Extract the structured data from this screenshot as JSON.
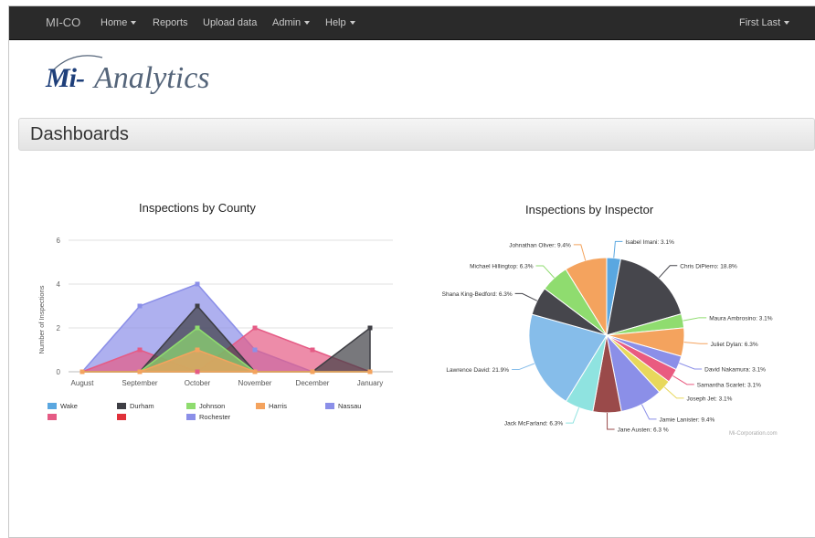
{
  "navbar": {
    "brand": "MI-CO",
    "items": [
      {
        "label": "Home",
        "dropdown": true
      },
      {
        "label": "Reports",
        "dropdown": false
      },
      {
        "label": "Upload data",
        "dropdown": false
      },
      {
        "label": "Admin",
        "dropdown": true
      },
      {
        "label": "Help",
        "dropdown": true
      }
    ],
    "user": "First Last"
  },
  "logo": {
    "mi": "Mi-",
    "rest": "Analytics"
  },
  "page_title": "Dashboards",
  "watermark": "Mi-Corporation.com",
  "chart_data": [
    {
      "type": "area",
      "title": "Inspections by County",
      "ylabel": "Number of Inspections",
      "xlabel": "",
      "categories": [
        "August",
        "September",
        "October",
        "November",
        "December",
        "January"
      ],
      "ylim": [
        0,
        6
      ],
      "yticks": [
        0,
        2,
        4,
        6
      ],
      "legend_position": "bottom",
      "series": [
        {
          "name": "Wake",
          "color": "#5aa7e0",
          "values": [
            0,
            0,
            0,
            0,
            0,
            0
          ]
        },
        {
          "name": "Durham",
          "color": "#3e3e44",
          "values": [
            0,
            0,
            3,
            0,
            0,
            2
          ]
        },
        {
          "name": "Johnson",
          "color": "#8fdc6f",
          "values": [
            0,
            0,
            2,
            0,
            0,
            0
          ]
        },
        {
          "name": "Harris",
          "color": "#f4a35e",
          "values": [
            0,
            0,
            1,
            0,
            0,
            0
          ]
        },
        {
          "name": "Nassau",
          "color": "#8b8fe8",
          "values": [
            0,
            3,
            4,
            1,
            0,
            0
          ]
        },
        {
          "name": "",
          "color": "#e55b85",
          "values": [
            0,
            1,
            0,
            2,
            1,
            0
          ]
        },
        {
          "name": "",
          "color": "#e0313a",
          "values": [
            0,
            0,
            0,
            0,
            0,
            0
          ]
        },
        {
          "name": "Rochester",
          "color": "#8b8fe8",
          "values": [
            0,
            0,
            0,
            0,
            0,
            0
          ]
        }
      ]
    },
    {
      "type": "pie",
      "title": "Inspections by Inspector",
      "slices": [
        {
          "label": "Isabel Imani: 3.1%",
          "value": 3.1,
          "color": "#5aa7e0"
        },
        {
          "label": "Chris DiPierro: 18.8%",
          "value": 18.8,
          "color": "#46464c"
        },
        {
          "label": "Maura Ambrosino: 3.1%",
          "value": 3.1,
          "color": "#8fdc6f"
        },
        {
          "label": "Juliet Dylan: 6.3%",
          "value": 6.3,
          "color": "#f4a35e"
        },
        {
          "label": "David Nakamura: 3.1%",
          "value": 3.1,
          "color": "#8b8fe8"
        },
        {
          "label": "Samantha Scarlet: 3.1%",
          "value": 3.1,
          "color": "#e95b80"
        },
        {
          "label": "Joseph Jet: 3.1%",
          "value": 3.1,
          "color": "#e8d85c"
        },
        {
          "label": "Jamie Lanister: 9.4%",
          "value": 9.4,
          "color": "#8b8fe8"
        },
        {
          "label": "Jane Austen: 6.3 %",
          "value": 6.3,
          "color": "#9a4a4a"
        },
        {
          "label": "Jack McFarland: 6.3%",
          "value": 6.3,
          "color": "#8fe3e0"
        },
        {
          "label": "Lawrence David: 21.9%",
          "value": 21.9,
          "color": "#86bdea"
        },
        {
          "label": "Shana King-Bedford: 6.3%",
          "value": 6.3,
          "color": "#46464c"
        },
        {
          "label": "Michael Hillingtop: 6.3%",
          "value": 6.3,
          "color": "#8fdc6f"
        },
        {
          "label": "Johnathan Oliver: 9.4%",
          "value": 9.4,
          "color": "#f4a35e"
        }
      ]
    }
  ]
}
